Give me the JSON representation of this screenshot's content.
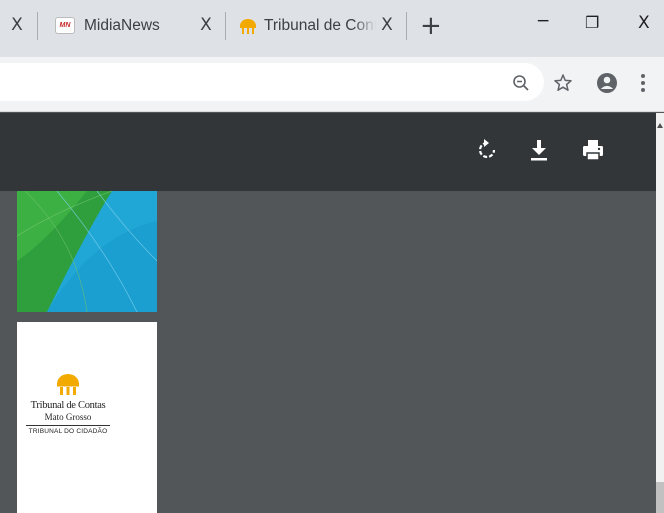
{
  "browser": {
    "tabs": [
      {
        "title": "",
        "favicon": "none"
      },
      {
        "title": "MidiaNews",
        "favicon": "midianews-logo"
      },
      {
        "title": "Tribunal de Contas",
        "favicon": "tce-building-logo"
      }
    ],
    "close_glyph": "X",
    "new_tab_glyph": "+",
    "window": {
      "minimize_glyph": "−",
      "restore_glyph": "❐",
      "close_glyph": "X"
    },
    "favicon_text": "MN",
    "toolbar_icons": [
      "zoom-out-icon",
      "star-icon",
      "account-icon",
      "more-icon"
    ]
  },
  "pdf_viewer": {
    "buttons": [
      "rotate-icon",
      "download-icon",
      "print-icon"
    ],
    "toolbar_color": "#323639",
    "background_color": "#525659"
  },
  "document": {
    "logo_title": "Tribunal de Contas",
    "logo_subtitle": "Mato Grosso",
    "logo_tagline": "TRIBUNAL DO CIDADÃO",
    "brand_color": "#f2a900"
  }
}
